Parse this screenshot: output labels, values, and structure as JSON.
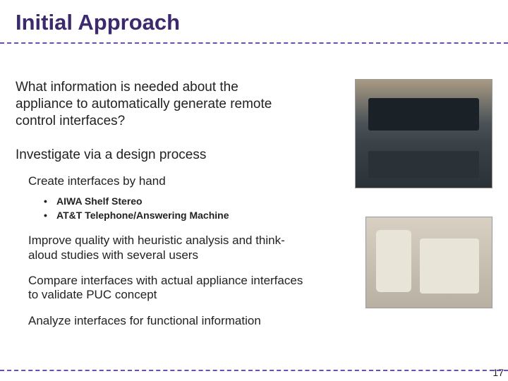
{
  "title": "Initial Approach",
  "lead": "What information is needed about the appliance to automatically generate remote control interfaces?",
  "subhead": "Investigate via a design process",
  "body": {
    "create": "Create interfaces by hand",
    "bullets": [
      "AIWA Shelf Stereo",
      "AT&T Telephone/Answering Machine"
    ],
    "improve": "Improve quality with heuristic analysis and think-aloud studies with several users",
    "compare": "Compare interfaces with actual appliance interfaces to validate PUC concept",
    "analyze": "Analyze interfaces for functional information"
  },
  "images": {
    "stereo_alt": "AIWA shelf stereo photograph",
    "phone_alt": "AT&T telephone answering machine photograph"
  },
  "page_number": "17"
}
